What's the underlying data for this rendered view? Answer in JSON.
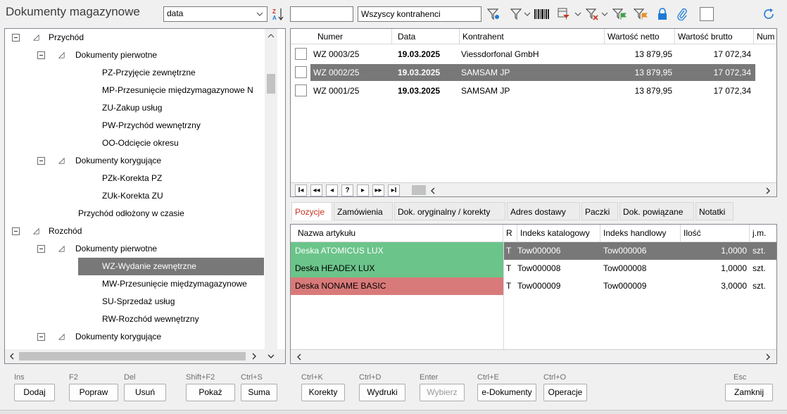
{
  "header": {
    "title": "Dokumenty magazynowe",
    "filter_select": "data",
    "search_value": "",
    "contractor_value": "Wszyscy kontrahenci"
  },
  "tree": {
    "items": [
      {
        "label": "Przychód"
      },
      {
        "label": "Dokumenty pierwotne"
      },
      {
        "label": "PZ-Przyjęcie zewnętrzne"
      },
      {
        "label": "MP-Przesunięcie międzymagazynowe N"
      },
      {
        "label": "ZU-Zakup usług"
      },
      {
        "label": "PW-Przychód wewnętrzny"
      },
      {
        "label": "OO-Odcięcie okresu"
      },
      {
        "label": "Dokumenty korygujące"
      },
      {
        "label": "PZk-Korekta PZ"
      },
      {
        "label": "ZUk-Korekta ZU"
      },
      {
        "label": "Przychód odłożony w czasie"
      },
      {
        "label": "Rozchód"
      },
      {
        "label": "Dokumenty pierwotne"
      },
      {
        "label": "WZ-Wydanie zewnętrzne"
      },
      {
        "label": "MW-Przesunięcie międzymagazynowe"
      },
      {
        "label": "SU-Sprzedaż usług"
      },
      {
        "label": "RW-Rozchód wewnętrzny"
      },
      {
        "label": "Dokumenty korygujące"
      }
    ]
  },
  "docs": {
    "columns": [
      "Numer",
      "Data",
      "Kontrahent",
      "Wartość netto",
      "Wartość brutto",
      "Num"
    ],
    "rows": [
      {
        "numer": "WZ 0003/25",
        "data": "19.03.2025",
        "kontrahent": "Viessdorfonal GmbH",
        "netto": "13 879,95",
        "brutto": "17 072,34"
      },
      {
        "numer": "WZ 0002/25",
        "data": "19.03.2025",
        "kontrahent": "SAMSAM JP",
        "netto": "13 879,95",
        "brutto": "17 072,34"
      },
      {
        "numer": "WZ 0001/25",
        "data": "19.03.2025",
        "kontrahent": "SAMSAM JP",
        "netto": "13 879,95",
        "brutto": "17 072,34"
      }
    ],
    "nav": [
      "I◂",
      "◂◂",
      "◂",
      "?",
      "▸",
      "▸▸",
      "▸I"
    ]
  },
  "tabs": [
    "Pozycje",
    "Zamówienia",
    "Dok. oryginalny / korekty",
    "Adres dostawy",
    "Paczki",
    "Dok. powiązane",
    "Notatki"
  ],
  "positions": {
    "columns": [
      "Nazwa artykułu",
      "R",
      "Indeks katalogowy",
      "Indeks handlowy",
      "Ilość",
      "j.m."
    ],
    "rows": [
      {
        "nazwa": "Deska ATOMICUS LUX",
        "r": "T",
        "katalogowy": "Tow000006",
        "handlowy": "Tow000006",
        "ilosc": "1,0000",
        "jm": "szt."
      },
      {
        "nazwa": "Deska HEADEX LUX",
        "r": "T",
        "katalogowy": "Tow000008",
        "handlowy": "Tow000008",
        "ilosc": "1,0000",
        "jm": "szt."
      },
      {
        "nazwa": "Deska NONAME BASIC",
        "r": "T",
        "katalogowy": "Tow000009",
        "handlowy": "Tow000009",
        "ilosc": "3,0000",
        "jm": "szt."
      }
    ]
  },
  "footer": {
    "buttons": [
      {
        "key": "Ins",
        "label": "Dodaj"
      },
      {
        "key": "F2",
        "label": "Popraw"
      },
      {
        "key": "Del",
        "label": "Usuń"
      },
      {
        "key": "Shift+F2",
        "label": "Pokaż"
      },
      {
        "key": "Ctrl+S",
        "label": "Suma"
      },
      {
        "key": "Ctrl+K",
        "label": "Korekty"
      },
      {
        "key": "Ctrl+D",
        "label": "Wydruki"
      },
      {
        "key": "Enter",
        "label": "Wybierz"
      },
      {
        "key": "Ctrl+E",
        "label": "e-Dokumenty"
      },
      {
        "key": "Ctrl+O",
        "label": "Operacje"
      },
      {
        "key": "Esc",
        "label": "Zamknij"
      }
    ]
  },
  "colors": {
    "selected": "#787878",
    "green_row": "#6bc48a",
    "red_row": "#d97a7a",
    "active_tab": "#c8321e",
    "accent": "#1e7ad6"
  }
}
